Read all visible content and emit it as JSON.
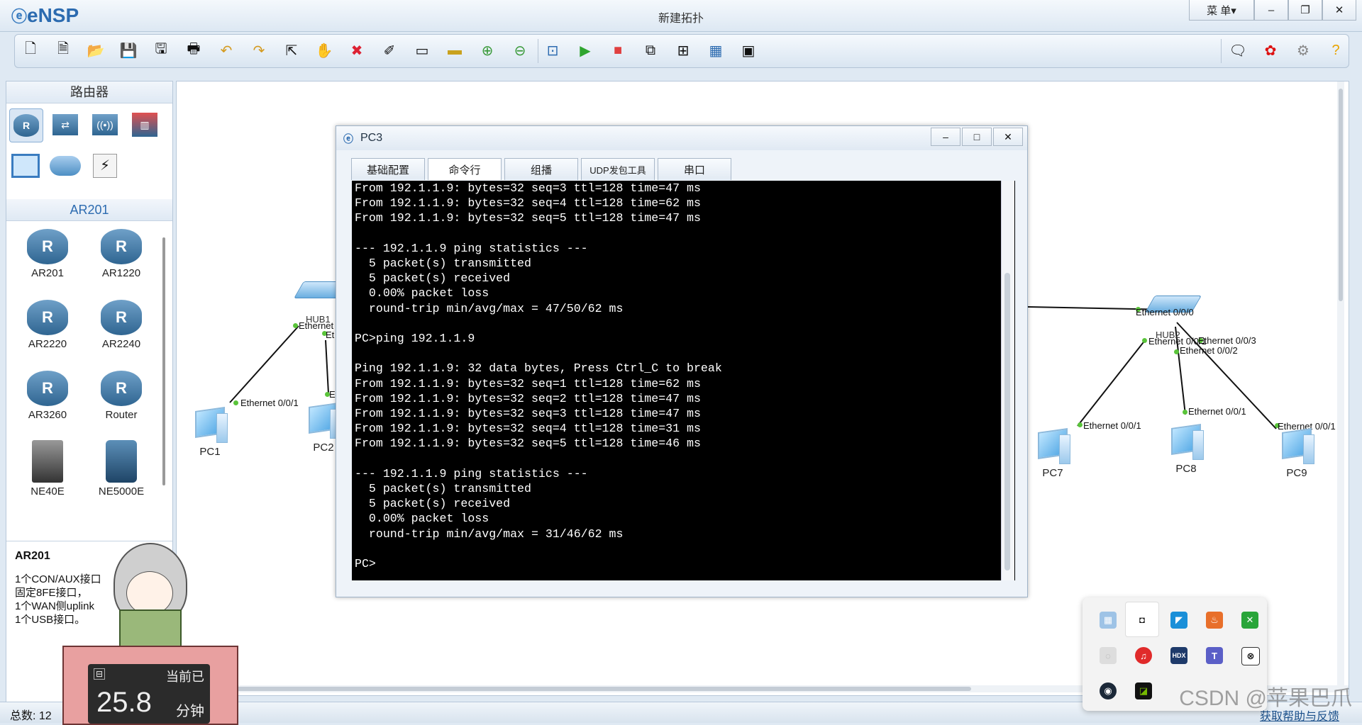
{
  "app": {
    "logo": "eNSP",
    "title": "新建拓扑",
    "menu_label": "菜 单▾"
  },
  "toolbar": {
    "icons": [
      "new-topology-icon",
      "new-lab-icon",
      "open-icon",
      "save-icon",
      "save-as-icon",
      "print-icon",
      "undo-icon",
      "redo-icon",
      "select-icon",
      "hand-icon",
      "delete-icon",
      "delete-all-links-icon",
      "text-icon",
      "shape-icon",
      "zoom-in-icon",
      "zoom-out-icon",
      "fit-icon",
      "start-icon",
      "stop-icon",
      "capture-icon",
      "topology-icon",
      "grid-icon",
      "terminal-icon"
    ],
    "right_icons": [
      "chat-icon",
      "huawei-icon",
      "settings-icon",
      "help-icon"
    ]
  },
  "left_panel": {
    "category_title": "路由器",
    "sub_title": "AR201",
    "devices": [
      {
        "name": "AR201"
      },
      {
        "name": "AR1220"
      },
      {
        "name": "AR2220"
      },
      {
        "name": "AR2240"
      },
      {
        "name": "AR3260"
      },
      {
        "name": "Router"
      },
      {
        "name": "NE40E"
      },
      {
        "name": "NE5000E"
      }
    ],
    "desc_title": "AR201",
    "desc_lines": [
      "1个CON/AUX接口",
      "固定8FE接口，",
      "1个WAN侧uplink",
      "1个USB接口。"
    ]
  },
  "topology": {
    "pcs": [
      "PC1",
      "PC2",
      "PC7",
      "PC8",
      "PC9"
    ],
    "hubs": [
      "HUB1",
      "HUB2"
    ],
    "labels": {
      "pc1_port": "Ethernet 0/0/1",
      "hub1_port_a": "Ethernet",
      "hub1_port_b": "Et",
      "pc2_port": "E",
      "hub2_port0": "Ethernet 0/0/0",
      "hub2_port1": "Ethernet 0/0/1",
      "hub2_port2": "Ethernet 0/0/2",
      "hub2_port3": "Ethernet 0/0/3",
      "pc7_port": "Ethernet 0/0/1",
      "pc8_port": "Ethernet 0/0/1",
      "pc9_port": "Ethernet 0/0/1"
    }
  },
  "dialog": {
    "title": "PC3",
    "tabs": [
      "基础配置",
      "命令行",
      "组播",
      "UDP发包工具",
      "串口"
    ],
    "terminal_lines": [
      "From 192.1.1.9: bytes=32 seq=3 ttl=128 time=47 ms",
      "From 192.1.1.9: bytes=32 seq=4 ttl=128 time=62 ms",
      "From 192.1.1.9: bytes=32 seq=5 ttl=128 time=47 ms",
      "",
      "--- 192.1.1.9 ping statistics ---",
      "  5 packet(s) transmitted",
      "  5 packet(s) received",
      "  0.00% packet loss",
      "  round-trip min/avg/max = 47/50/62 ms",
      "",
      "PC>ping 192.1.1.9",
      "",
      "Ping 192.1.1.9: 32 data bytes, Press Ctrl_C to break",
      "From 192.1.1.9: bytes=32 seq=1 ttl=128 time=62 ms",
      "From 192.1.1.9: bytes=32 seq=2 ttl=128 time=47 ms",
      "From 192.1.1.9: bytes=32 seq=3 ttl=128 time=47 ms",
      "From 192.1.1.9: bytes=32 seq=4 ttl=128 time=31 ms",
      "From 192.1.1.9: bytes=32 seq=5 ttl=128 time=46 ms",
      "",
      "--- 192.1.1.9 ping statistics ---",
      "  5 packet(s) transmitted",
      "  5 packet(s) received",
      "  0.00% packet loss",
      "  round-trip min/avg/max = 31/46/62 ms",
      "",
      "PC>"
    ]
  },
  "status": {
    "count_label": "总数: 12",
    "help_link": "获取帮助与反馈"
  },
  "widget": {
    "label": "当前已",
    "value": "25.8",
    "unit": "分钟"
  },
  "watermark": "CSDN @苹果巴爪"
}
